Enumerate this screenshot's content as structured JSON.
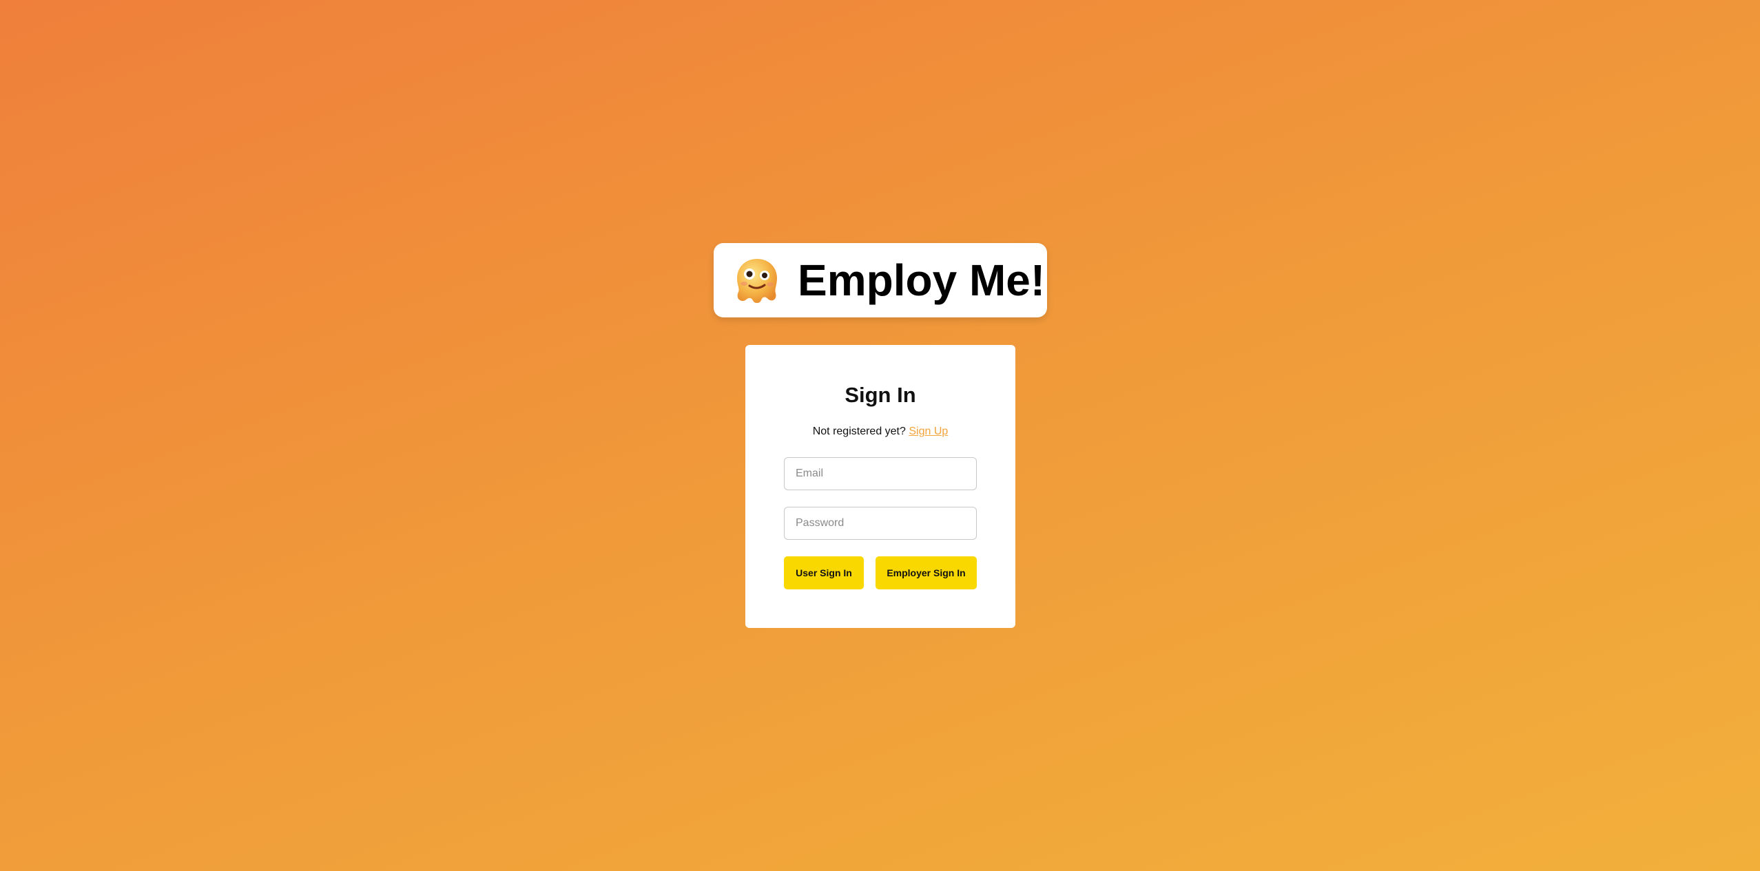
{
  "brand": {
    "logo_icon": "melting-face-emoji",
    "title": "Employ Me!"
  },
  "signin": {
    "title": "Sign In",
    "prompt": "Not registered yet?",
    "signup_link": "Sign Up",
    "email_placeholder": "Email",
    "password_placeholder": "Password",
    "user_button": "User Sign In",
    "employer_button": "Employer Sign In"
  },
  "colors": {
    "background_start": "#ef7f3b",
    "background_end": "#f2b03b",
    "accent_link": "#f2a33a",
    "button": "#f9d800"
  }
}
